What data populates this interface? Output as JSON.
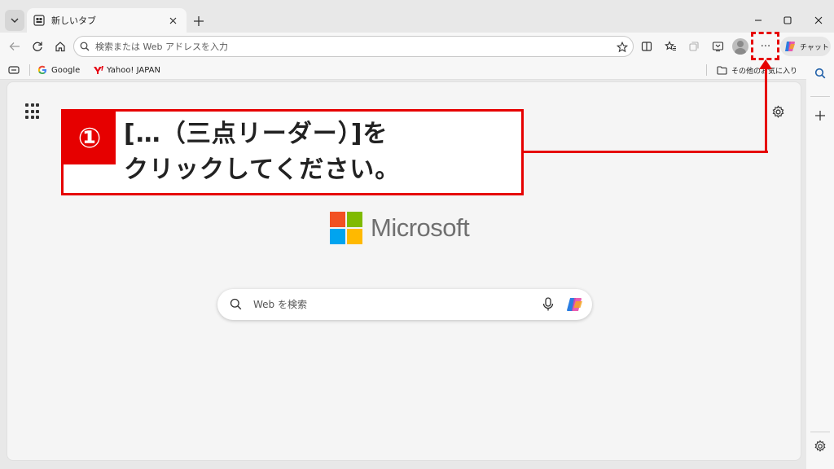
{
  "tab": {
    "title": "新しいタブ"
  },
  "address": {
    "placeholder": "検索または Web アドレスを入力"
  },
  "toolbar": {
    "more_label": "···",
    "chat_label": "チャット"
  },
  "favorites": {
    "items": [
      {
        "label": "Google"
      },
      {
        "label": "Yahoo! JAPAN"
      }
    ],
    "other_label": "その他のお気に入り"
  },
  "content": {
    "brand": "Microsoft",
    "search_placeholder": "Web を検索"
  },
  "annotation": {
    "number": "①",
    "text": "[…（三点リーダー）]を\nクリックしてください。"
  },
  "colors": {
    "accent": "#e60000",
    "ms_red": "#f25022",
    "ms_green": "#7fba00",
    "ms_blue": "#00a4ef",
    "ms_yellow": "#ffb900"
  }
}
